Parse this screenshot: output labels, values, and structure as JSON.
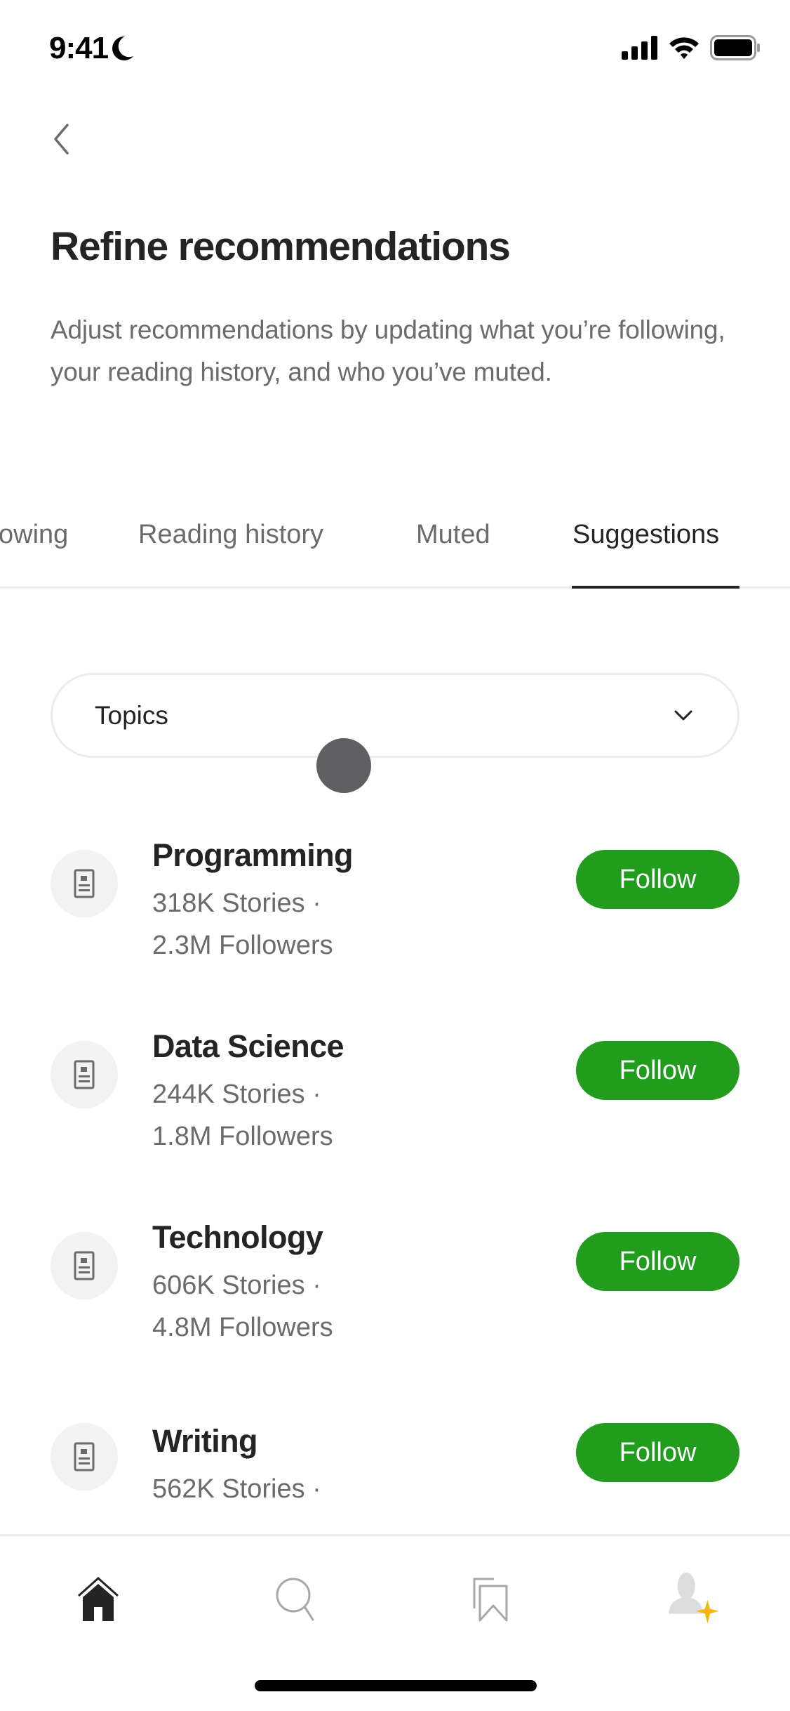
{
  "status_bar": {
    "time": "9:41",
    "focus_icon": "moon-icon",
    "signal_icon": "cellular-signal-icon",
    "wifi_icon": "wifi-icon",
    "battery_icon": "battery-icon"
  },
  "header": {
    "back_icon": "chevron-left-icon",
    "title": "Refine recommendations",
    "description": "Adjust recommendations by updating what you’re following, your reading history, and who you’ve muted."
  },
  "tabs": [
    {
      "label": "Following",
      "visible_label": "owing",
      "active": false
    },
    {
      "label": "Reading history",
      "active": false
    },
    {
      "label": "Muted",
      "active": false
    },
    {
      "label": "Suggestions",
      "active": true
    }
  ],
  "filter": {
    "selected": "Topics",
    "icon": "chevron-down-icon"
  },
  "topics": [
    {
      "name": "Programming",
      "stories": "318K Stories ·",
      "followers": "2.3M Followers",
      "button": "Follow"
    },
    {
      "name": "Data Science",
      "stories": "244K Stories ·",
      "followers": "1.8M Followers",
      "button": "Follow"
    },
    {
      "name": "Technology",
      "stories": "606K Stories ·",
      "followers": "4.8M Followers",
      "button": "Follow"
    },
    {
      "name": "Writing",
      "stories": "562K Stories ·",
      "followers": "",
      "button": "Follow"
    }
  ],
  "bottom_nav": [
    {
      "name": "home",
      "icon": "home-icon",
      "active": true
    },
    {
      "name": "search",
      "icon": "search-icon",
      "active": false
    },
    {
      "name": "library",
      "icon": "bookmarks-icon",
      "active": false
    },
    {
      "name": "profile",
      "icon": "profile-icon",
      "active": false
    }
  ],
  "colors": {
    "accent_green": "#219c1c",
    "text_primary": "#242424",
    "text_secondary": "#6b6b6b",
    "divider": "#ececec",
    "star": "#f5b80f"
  }
}
